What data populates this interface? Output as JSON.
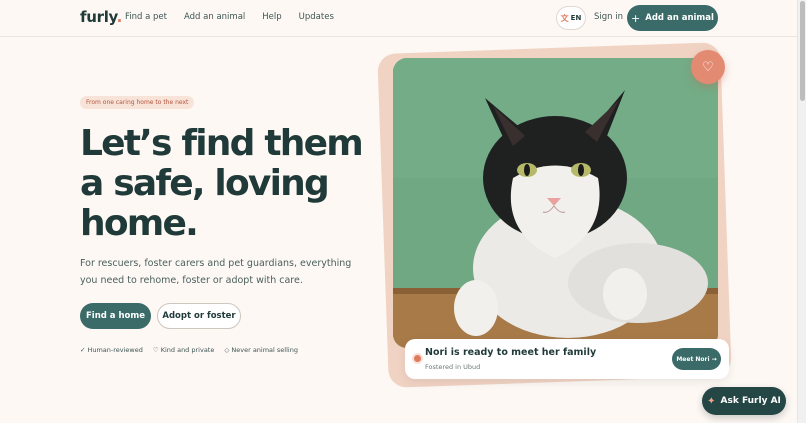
{
  "header": {
    "logo": "furly",
    "logo_dot": ".",
    "nav": [
      "Find a pet",
      "Add an animal",
      "Help",
      "Updates"
    ],
    "lang": "EN",
    "signin": "Sign in",
    "add_animal": "Add an animal"
  },
  "hero": {
    "tagline": "From one caring home to the next",
    "headline_1": "Let’s find them",
    "headline_2": "a safe, loving",
    "headline_3": "home.",
    "subtext": "For rescuers, foster carers and pet guardians, everything you need to rehome, foster or adopt with care.",
    "primary_button": "Find a home",
    "secondary_button": "Adopt or foster",
    "trust": [
      {
        "mark": "✓",
        "label": "Human-reviewed"
      },
      {
        "mark": "♡",
        "label": "Kind and private"
      },
      {
        "mark": "◇",
        "label": "Never animal selling"
      }
    ]
  },
  "pet_card": {
    "title": "Nori is ready to meet her family",
    "subtitle": "Fostered in Ubud",
    "button": "Meet Nori →"
  },
  "assistant": {
    "label": "Ask Furly AI"
  },
  "colors": {
    "primary": "#3b6b69",
    "accent": "#e07a5f",
    "background": "#fdf8f4"
  },
  "icons": {
    "lang": "globe-icon",
    "add": "plus-icon",
    "favorite": "heart-icon",
    "assistant": "sparkle-icon"
  }
}
